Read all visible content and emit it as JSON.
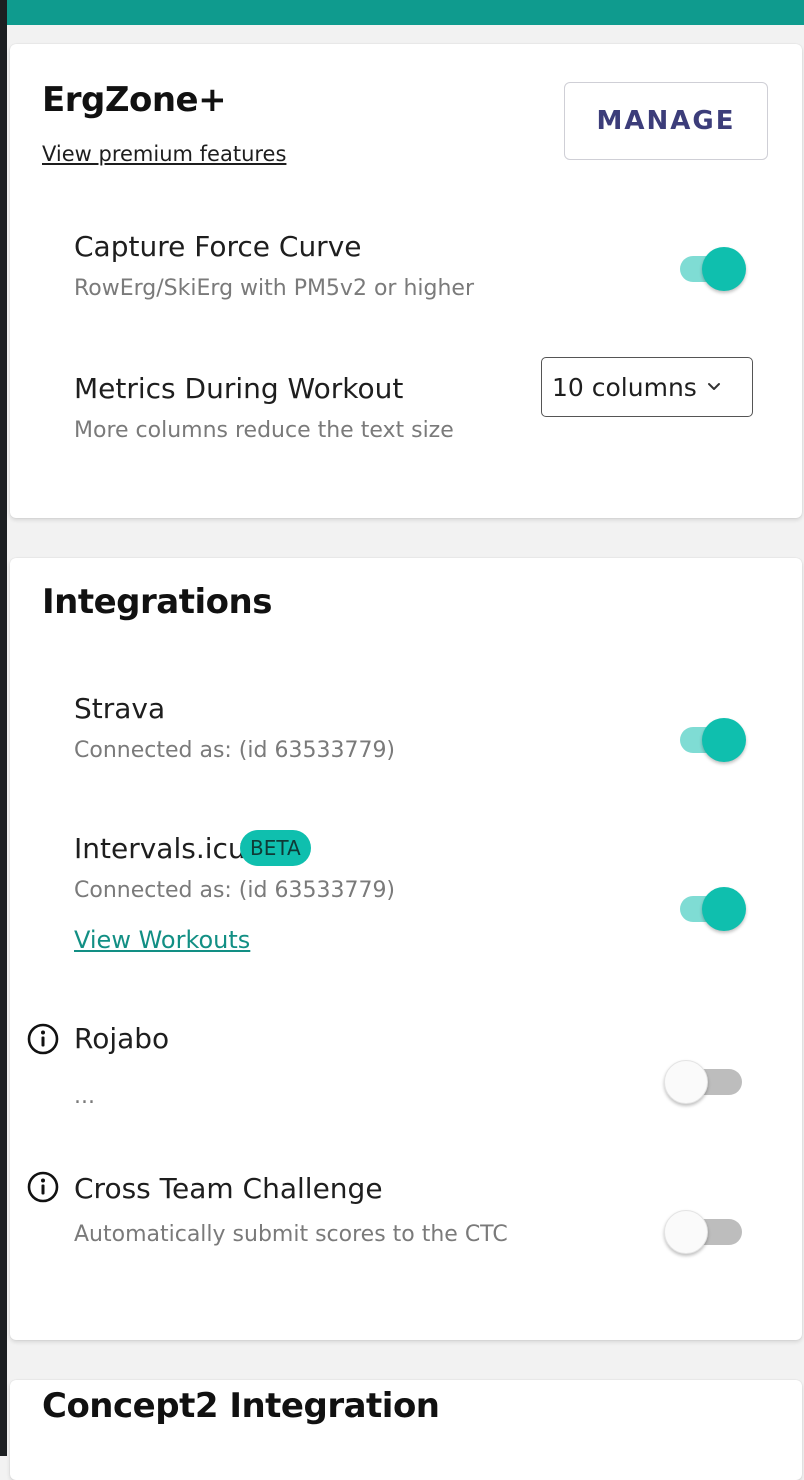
{
  "ergzone": {
    "title": "ErgZone+",
    "premium_link": "View premium features",
    "manage_label": "MANAGE",
    "force_curve": {
      "title": "Capture Force Curve",
      "subtitle": "RowErg/SkiErg with PM5v2 or higher",
      "enabled": true
    },
    "metrics": {
      "title": "Metrics During Workout",
      "subtitle": "More columns reduce the text size",
      "selected": "10 columns"
    }
  },
  "integrations": {
    "title": "Integrations",
    "strava": {
      "title": "Strava",
      "subtitle": "Connected as:  (id 63533779)",
      "enabled": true
    },
    "intervals": {
      "title": "Intervals.icu",
      "badge": "BETA",
      "subtitle": "Connected as: (id 63533779)",
      "link": "View Workouts",
      "enabled": true
    },
    "rojabo": {
      "title": "Rojabo",
      "subtitle": "...",
      "enabled": false
    },
    "ctc": {
      "title": "Cross Team Challenge",
      "subtitle": "Automatically submit scores to the CTC",
      "enabled": false
    }
  },
  "concept2": {
    "title": "Concept2 Integration"
  },
  "colors": {
    "accent": "#0fbfae",
    "topbar": "#0f9b8e",
    "manage_text": "#3c3d7a"
  }
}
